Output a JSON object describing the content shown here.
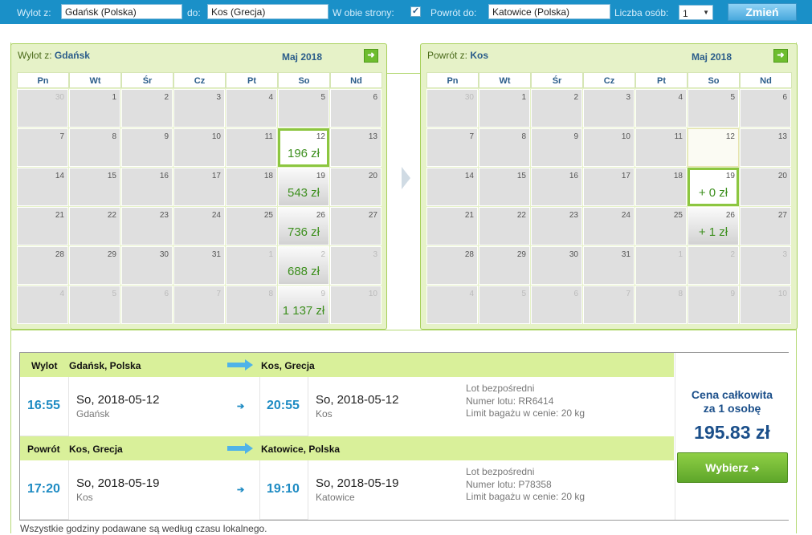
{
  "search": {
    "from_label": "Wylot z:",
    "from_value": "Gdańsk (Polska)",
    "to_label": "do:",
    "to_value": "Kos (Grecja)",
    "roundtrip_label": "W obie strony:",
    "roundtrip_checked": "✓",
    "return_label": "Powrót do:",
    "return_value": "Katowice (Polska)",
    "persons_label": "Liczba osób:",
    "persons_value": "1",
    "change_button": "Zmień"
  },
  "calendar_left": {
    "title_prefix": "Wylot z:",
    "title_city": "Gdańsk",
    "month": "Maj 2018",
    "weekdays": [
      "Pn",
      "Wt",
      "Śr",
      "Cz",
      "Pt",
      "So",
      "Nd"
    ],
    "weeks": [
      [
        {
          "d": "30",
          "o": 1
        },
        {
          "d": "1"
        },
        {
          "d": "2"
        },
        {
          "d": "3"
        },
        {
          "d": "4"
        },
        {
          "d": "5"
        },
        {
          "d": "6"
        }
      ],
      [
        {
          "d": "7"
        },
        {
          "d": "8"
        },
        {
          "d": "9"
        },
        {
          "d": "10"
        },
        {
          "d": "11"
        },
        {
          "d": "12",
          "p": "196 zł",
          "s": 1
        },
        {
          "d": "13"
        }
      ],
      [
        {
          "d": "14"
        },
        {
          "d": "15"
        },
        {
          "d": "16"
        },
        {
          "d": "17"
        },
        {
          "d": "18"
        },
        {
          "d": "19",
          "p": "543 zł"
        },
        {
          "d": "20"
        }
      ],
      [
        {
          "d": "21"
        },
        {
          "d": "22"
        },
        {
          "d": "23"
        },
        {
          "d": "24"
        },
        {
          "d": "25"
        },
        {
          "d": "26",
          "p": "736 zł"
        },
        {
          "d": "27"
        }
      ],
      [
        {
          "d": "28"
        },
        {
          "d": "29"
        },
        {
          "d": "30"
        },
        {
          "d": "31"
        },
        {
          "d": "1",
          "o": 1
        },
        {
          "d": "2",
          "o": 1,
          "p": "688 zł"
        },
        {
          "d": "3",
          "o": 1
        }
      ],
      [
        {
          "d": "4",
          "o": 1
        },
        {
          "d": "5",
          "o": 1
        },
        {
          "d": "6",
          "o": 1
        },
        {
          "d": "7",
          "o": 1
        },
        {
          "d": "8",
          "o": 1
        },
        {
          "d": "9",
          "o": 1,
          "p": "1 137 zł"
        },
        {
          "d": "10",
          "o": 1
        }
      ]
    ]
  },
  "calendar_right": {
    "title_prefix": "Powrót z:",
    "title_city": "Kos",
    "month": "Maj 2018",
    "weekdays": [
      "Pn",
      "Wt",
      "Śr",
      "Cz",
      "Pt",
      "So",
      "Nd"
    ],
    "weeks": [
      [
        {
          "d": "30",
          "o": 1
        },
        {
          "d": "1"
        },
        {
          "d": "2"
        },
        {
          "d": "3"
        },
        {
          "d": "4"
        },
        {
          "d": "5"
        },
        {
          "d": "6"
        }
      ],
      [
        {
          "d": "7"
        },
        {
          "d": "8"
        },
        {
          "d": "9"
        },
        {
          "d": "10"
        },
        {
          "d": "11"
        },
        {
          "d": "12",
          "s2": 1
        },
        {
          "d": "13"
        }
      ],
      [
        {
          "d": "14"
        },
        {
          "d": "15"
        },
        {
          "d": "16"
        },
        {
          "d": "17"
        },
        {
          "d": "18"
        },
        {
          "d": "19",
          "p": "+ 0 zł",
          "s": 1
        },
        {
          "d": "20"
        }
      ],
      [
        {
          "d": "21"
        },
        {
          "d": "22"
        },
        {
          "d": "23"
        },
        {
          "d": "24"
        },
        {
          "d": "25"
        },
        {
          "d": "26",
          "p": "+ 1 zł"
        },
        {
          "d": "27"
        }
      ],
      [
        {
          "d": "28"
        },
        {
          "d": "29"
        },
        {
          "d": "30"
        },
        {
          "d": "31"
        },
        {
          "d": "1",
          "o": 1
        },
        {
          "d": "2",
          "o": 1
        },
        {
          "d": "3",
          "o": 1
        }
      ],
      [
        {
          "d": "4",
          "o": 1
        },
        {
          "d": "5",
          "o": 1
        },
        {
          "d": "6",
          "o": 1
        },
        {
          "d": "7",
          "o": 1
        },
        {
          "d": "8",
          "o": 1
        },
        {
          "d": "9",
          "o": 1
        },
        {
          "d": "10",
          "o": 1
        }
      ]
    ]
  },
  "outbound": {
    "label": "Wylot",
    "from": "Gdańsk, Polska",
    "to": "Kos, Grecja",
    "dep_time": "16:55",
    "dep_date": "So, 2018-05-12",
    "dep_city": "Gdańsk",
    "arr_time": "20:55",
    "arr_date": "So, 2018-05-12",
    "arr_city": "Kos",
    "info1": "Lot bezpośredni",
    "info2": "Numer lotu: RR6414",
    "info3": "Limit bagażu w cenie: 20 kg"
  },
  "inbound": {
    "label": "Powrót",
    "from": "Kos, Grecja",
    "to": "Katowice, Polska",
    "dep_time": "17:20",
    "dep_date": "So, 2018-05-19",
    "dep_city": "Kos",
    "arr_time": "19:10",
    "arr_date": "So, 2018-05-19",
    "arr_city": "Katowice",
    "info1": "Lot bezpośredni",
    "info2": "Numer lotu: P78358",
    "info3": "Limit bagażu w cenie: 20 kg"
  },
  "price": {
    "title_line1": "Cena całkowita",
    "title_line2": "za 1 osobę",
    "value": "195.83 zł",
    "select_button": "Wybierz"
  },
  "footer_note": "Wszystkie godziny podawane są według czasu lokalnego.",
  "icons": {
    "next_month": "arrow-right-icon",
    "route_arrow": "route-arrow-icon",
    "small_arrow": "small-arrow-icon"
  },
  "colors": {
    "search_bar": "#1a90c8",
    "calendar_bg": "#e6f2c8",
    "price_green": "#3d8f1e",
    "route_header": "#d9f09a",
    "time_blue": "#1e8bc3",
    "price_blue": "#1b4f8a",
    "button_green": "#6ab02e"
  }
}
